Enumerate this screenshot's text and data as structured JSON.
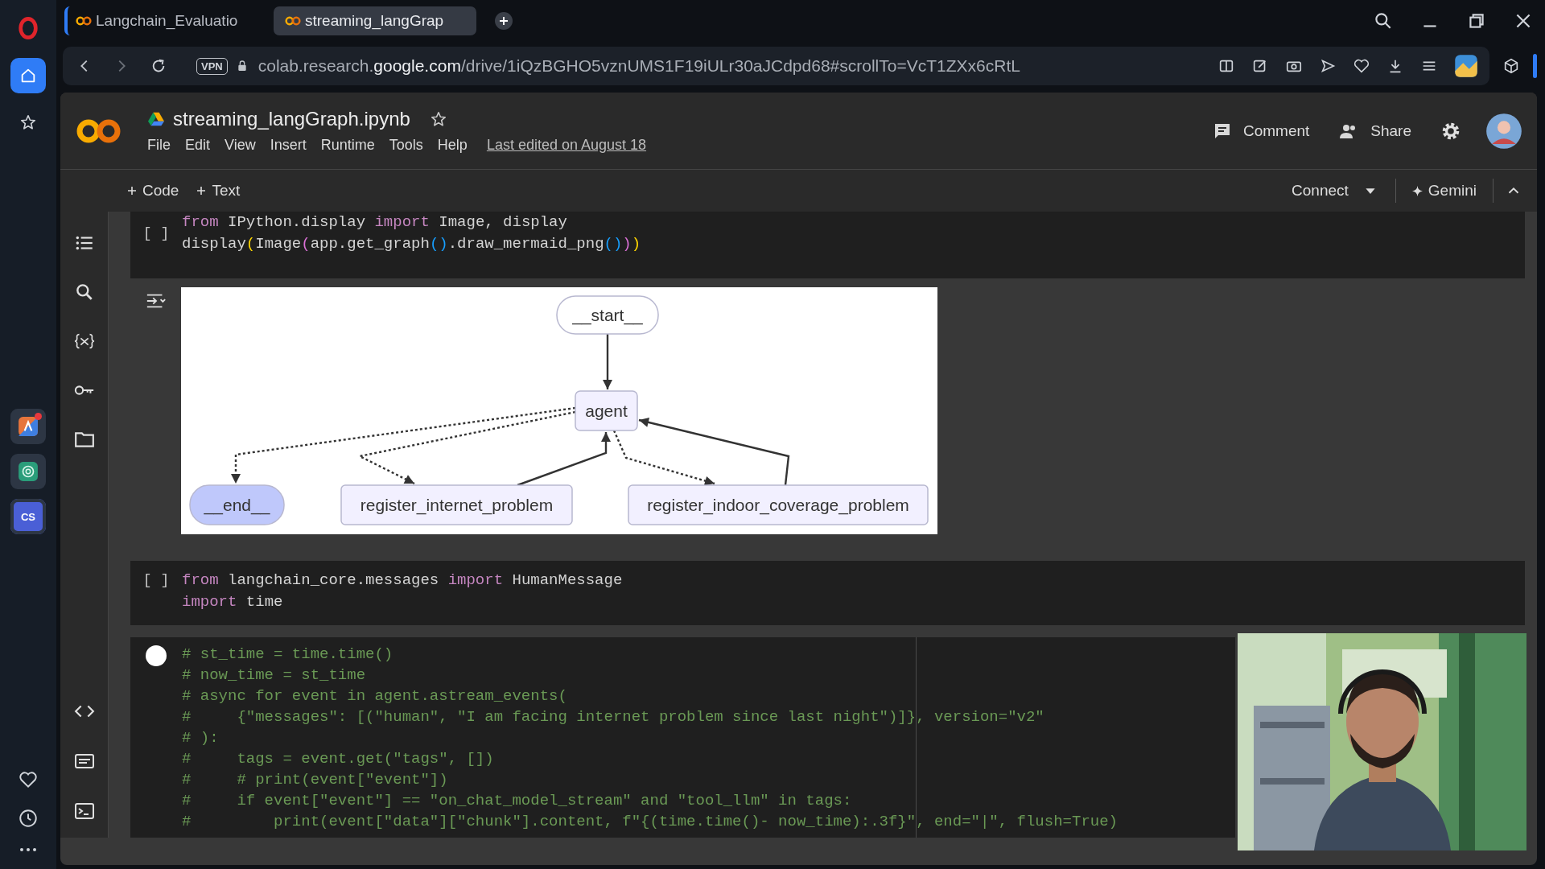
{
  "browser": {
    "tabs": [
      {
        "title": "Langchain_Evaluatio",
        "selected": false
      },
      {
        "title": "streaming_langGrap",
        "selected": true
      }
    ],
    "vpn": "VPN",
    "url": {
      "prefix": "colab.research.",
      "domain": "google.com",
      "path": "/drive/1iQzBGHO5vznUMS1F19iULr30aJCdpd68#scrollTo=VcT1ZXx6cRtL"
    }
  },
  "sidebar": {
    "nav": [
      {
        "kind": "home",
        "selected": true
      },
      {
        "kind": "star",
        "selected": false
      }
    ],
    "apps": [
      {
        "kind": "drawing",
        "badge": true
      },
      {
        "kind": "chat"
      },
      {
        "kind": "text",
        "label": "CS"
      }
    ]
  },
  "notebook": {
    "title": "streaming_langGraph.ipynb",
    "starred": false,
    "menu": [
      "File",
      "Edit",
      "View",
      "Insert",
      "Runtime",
      "Tools",
      "Help"
    ],
    "last_edited": "Last edited on August 18",
    "actions": [
      {
        "kind": "comment",
        "label": "Comment"
      },
      {
        "kind": "share",
        "label": "Share"
      }
    ]
  },
  "toolbar": {
    "add": [
      "Code",
      "Text"
    ],
    "connect": "Connect",
    "gemini": "Gemini"
  },
  "cells": [
    {
      "pending": false,
      "run_label": "[ ]",
      "lines": [
        [
          {
            "text": "from",
            "kind": "keyword"
          },
          {
            "text": " IPython.display ",
            "kind": "plain"
          },
          {
            "text": "import",
            "kind": "keyword"
          },
          {
            "text": " Image, display",
            "kind": "plain"
          }
        ],
        [
          {
            "text": "display",
            "kind": "plain"
          },
          {
            "text": "(",
            "kind": "bracket1"
          },
          {
            "text": "Image",
            "kind": "plain"
          },
          {
            "text": "(",
            "kind": "bracket2"
          },
          {
            "text": "app.get_graph",
            "kind": "plain"
          },
          {
            "text": "()",
            "kind": "bracket3"
          },
          {
            "text": ".draw_mermaid_png",
            "kind": "plain"
          },
          {
            "text": "()",
            "kind": "bracket3"
          },
          {
            "text": ")",
            "kind": "bracket2"
          },
          {
            "text": ")",
            "kind": "bracket1"
          }
        ]
      ],
      "output": {
        "kind": "graph",
        "nodes": [
          {
            "label": "__start__",
            "kind": "start"
          },
          {
            "label": "agent",
            "kind": "node"
          },
          {
            "label": "__end__",
            "kind": "end"
          },
          {
            "label": "register_internet_problem",
            "kind": "node"
          },
          {
            "label": "register_indoor_coverage_problem",
            "kind": "node"
          }
        ],
        "edges": [
          {
            "dashed": false
          },
          {
            "dashed": true
          },
          {
            "dashed": true
          },
          {
            "dashed": false
          },
          {
            "dashed": true
          },
          {
            "dashed": false
          }
        ]
      }
    },
    {
      "pending": false,
      "run_label": "[ ]",
      "lines": [
        [
          {
            "text": "from",
            "kind": "keyword"
          },
          {
            "text": " langchain_core.messages ",
            "kind": "plain"
          },
          {
            "text": "import",
            "kind": "keyword"
          },
          {
            "text": " HumanMessage",
            "kind": "plain"
          }
        ],
        [
          {
            "text": "import",
            "kind": "keyword"
          },
          {
            "text": " time",
            "kind": "plain"
          }
        ]
      ]
    },
    {
      "pending": true,
      "lines": [
        [
          {
            "text": "# st_time = time.time()",
            "kind": "comment"
          }
        ],
        [
          {
            "text": "# now_time = st_time",
            "kind": "comment"
          }
        ],
        [
          {
            "text": "# async for event in agent.astream_events(",
            "kind": "comment"
          }
        ],
        [
          {
            "text": "#     {\"messages\": [(\"human\", \"I am facing internet problem since last night\")]}, version=\"v2\"",
            "kind": "comment"
          }
        ],
        [
          {
            "text": "# ):",
            "kind": "comment"
          }
        ],
        [
          {
            "text": "#     tags = event.get(\"tags\", [])",
            "kind": "comment"
          }
        ],
        [
          {
            "text": "#     # print(event[\"event\"])",
            "kind": "comment"
          }
        ],
        [
          {
            "text": "#     if event[\"event\"] == \"on_chat_model_stream\" and \"tool_llm\" in tags:",
            "kind": "comment"
          }
        ],
        [
          {
            "text": "#         print(event[\"data\"][\"chunk\"].content, f\"{(time.time()- now_time):.3f}\", end=\"|\", flush=True)",
            "kind": "comment"
          }
        ]
      ]
    }
  ]
}
